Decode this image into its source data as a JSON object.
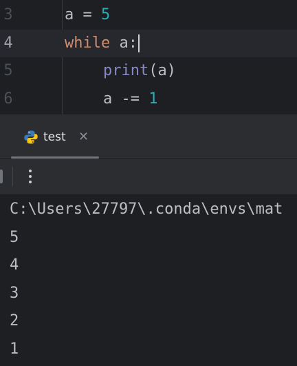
{
  "editor": {
    "lines": [
      {
        "number": "3",
        "indent": "",
        "tokens": [
          {
            "text": "a = ",
            "kind": "plain"
          },
          {
            "text": "5",
            "kind": "num"
          }
        ]
      },
      {
        "number": "4",
        "indent": "",
        "tokens": [
          {
            "text": "while",
            "kind": "kw"
          },
          {
            "text": " a:",
            "kind": "plain"
          }
        ]
      },
      {
        "number": "5",
        "indent": "    ",
        "tokens": [
          {
            "text": "print",
            "kind": "builtin"
          },
          {
            "text": "(a)",
            "kind": "plain"
          }
        ]
      },
      {
        "number": "6",
        "indent": "    ",
        "tokens": [
          {
            "text": "a -= ",
            "kind": "plain"
          },
          {
            "text": "1",
            "kind": "num"
          }
        ]
      }
    ],
    "current_line": "4"
  },
  "run_panel": {
    "tab": {
      "label": "test",
      "icon": "python-icon",
      "close_glyph": "✕"
    },
    "toolbar": {
      "more_icon": "more-vertical-icon"
    },
    "console": {
      "command_path": "C:\\Users\\27797\\.conda\\envs\\mat",
      "output": [
        "5",
        "4",
        "3",
        "2",
        "1"
      ]
    }
  },
  "colors": {
    "editor_bg": "#1e1f22",
    "panel_bg": "#2b2d30",
    "keyword": "#cf8e6d",
    "number": "#2aacb8",
    "builtin": "#8888c6",
    "text": "#bcbec4"
  }
}
